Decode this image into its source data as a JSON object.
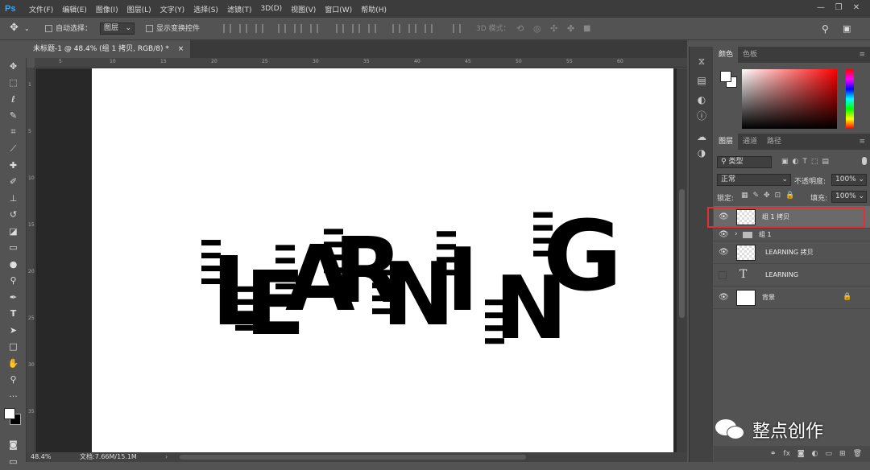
{
  "app_logo": "Ps",
  "menu": [
    "文件(F)",
    "编辑(E)",
    "图像(I)",
    "图层(L)",
    "文字(Y)",
    "选择(S)",
    "滤镜(T)",
    "3D(D)",
    "视图(V)",
    "窗口(W)",
    "帮助(H)"
  ],
  "window_buttons": {
    "minimize": "—",
    "restore": "❐",
    "close": "✕"
  },
  "options": {
    "auto_select_label": "自动选择：",
    "auto_select_value": "图层",
    "show_transform_label": "显示变换控件",
    "mode_3d_label": "3D 模式："
  },
  "document_tab": {
    "title": "未标题-1 @ 48.4% (组 1 拷贝, RGB/8) *",
    "close": "×"
  },
  "ruler": {
    "top_ticks": [
      "5",
      "10",
      "15",
      "20",
      "25",
      "30",
      "35",
      "40",
      "45",
      "50",
      "55",
      "60"
    ],
    "left_ticks": [
      "1",
      "5",
      "10",
      "15",
      "20",
      "25",
      "30",
      "35"
    ]
  },
  "status": {
    "zoom": "48.4%",
    "doc_size": "文档:7.66M/15.1M"
  },
  "panels": {
    "color_tabs": [
      "颜色",
      "色板"
    ],
    "layer_tabs": [
      "图层",
      "通道",
      "路径"
    ],
    "filter_kind": "类型",
    "blend_mode": "正常",
    "opacity_label": "不透明度:",
    "opacity_value": "100%",
    "lock_label": "锁定:",
    "fill_label": "填充:",
    "fill_value": "100%"
  },
  "layers": [
    {
      "name": "组 1 拷贝",
      "visible": true,
      "selected": true,
      "type": "smart"
    },
    {
      "name": "组 1",
      "visible": true,
      "selected": false,
      "type": "group"
    },
    {
      "name": "LEARNING 拷贝",
      "visible": true,
      "selected": false,
      "type": "raster"
    },
    {
      "name": "LEARNING",
      "visible": false,
      "selected": false,
      "type": "text"
    },
    {
      "name": "背景",
      "visible": true,
      "selected": false,
      "type": "background",
      "locked": true
    }
  ],
  "canvas_art": {
    "letters": [
      "L",
      "E",
      "A",
      "R",
      "N",
      "I",
      "N",
      "G"
    ]
  },
  "watermark": "整点创作",
  "colors": {
    "highlight_box": "#e03030",
    "selected_layer": "#6a6a6a",
    "accent_blue": "#31a8ff"
  }
}
